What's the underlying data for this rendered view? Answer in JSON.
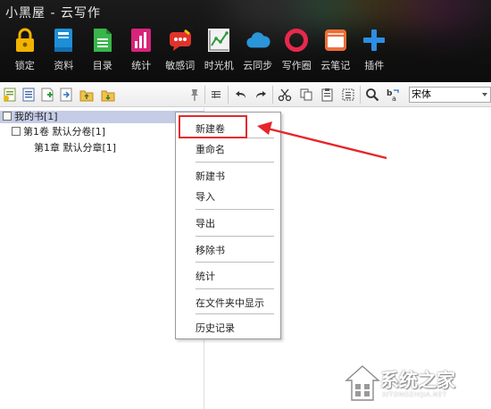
{
  "app": {
    "title": "小黑屋 - 云写作"
  },
  "tools": [
    {
      "label": "锁定",
      "icon": "lock-icon",
      "color": "#f2b400"
    },
    {
      "label": "资料",
      "icon": "book-icon",
      "color": "#1e8ed6"
    },
    {
      "label": "目录",
      "icon": "list-icon",
      "color": "#39b54a"
    },
    {
      "label": "统计",
      "icon": "bar-chart-icon",
      "color": "#d8237a"
    },
    {
      "label": "敏感词",
      "icon": "chat-bubble-icon",
      "color": "#e2332b"
    },
    {
      "label": "时光机",
      "icon": "line-chart-icon",
      "color": "#cfd4d8"
    },
    {
      "label": "云同步",
      "icon": "cloud-icon",
      "color": "#2b95d9"
    },
    {
      "label": "写作圈",
      "icon": "ring-icon",
      "color": "#e8294c"
    },
    {
      "label": "云笔记",
      "icon": "notebook-icon",
      "color": "#ec6e3a"
    },
    {
      "label": "插件",
      "icon": "plus-icon",
      "color": "#2c8fe3"
    }
  ],
  "toolbar": {
    "font_name": "宋体"
  },
  "tree": {
    "root": "我的书[1]",
    "volume": "第1卷 默认分卷[1]",
    "chapter": "第1章 默认分章[1]"
  },
  "context_menu": {
    "items": [
      "新建卷",
      "重命名",
      "新建书",
      "导入",
      "导出",
      "移除书",
      "统计",
      "在文件夹中显示",
      "历史记录"
    ]
  },
  "annotation": {
    "color": "#e6262b"
  },
  "watermark": {
    "text": "系统之家",
    "sub": "XITONGZHIJIA.NET"
  }
}
